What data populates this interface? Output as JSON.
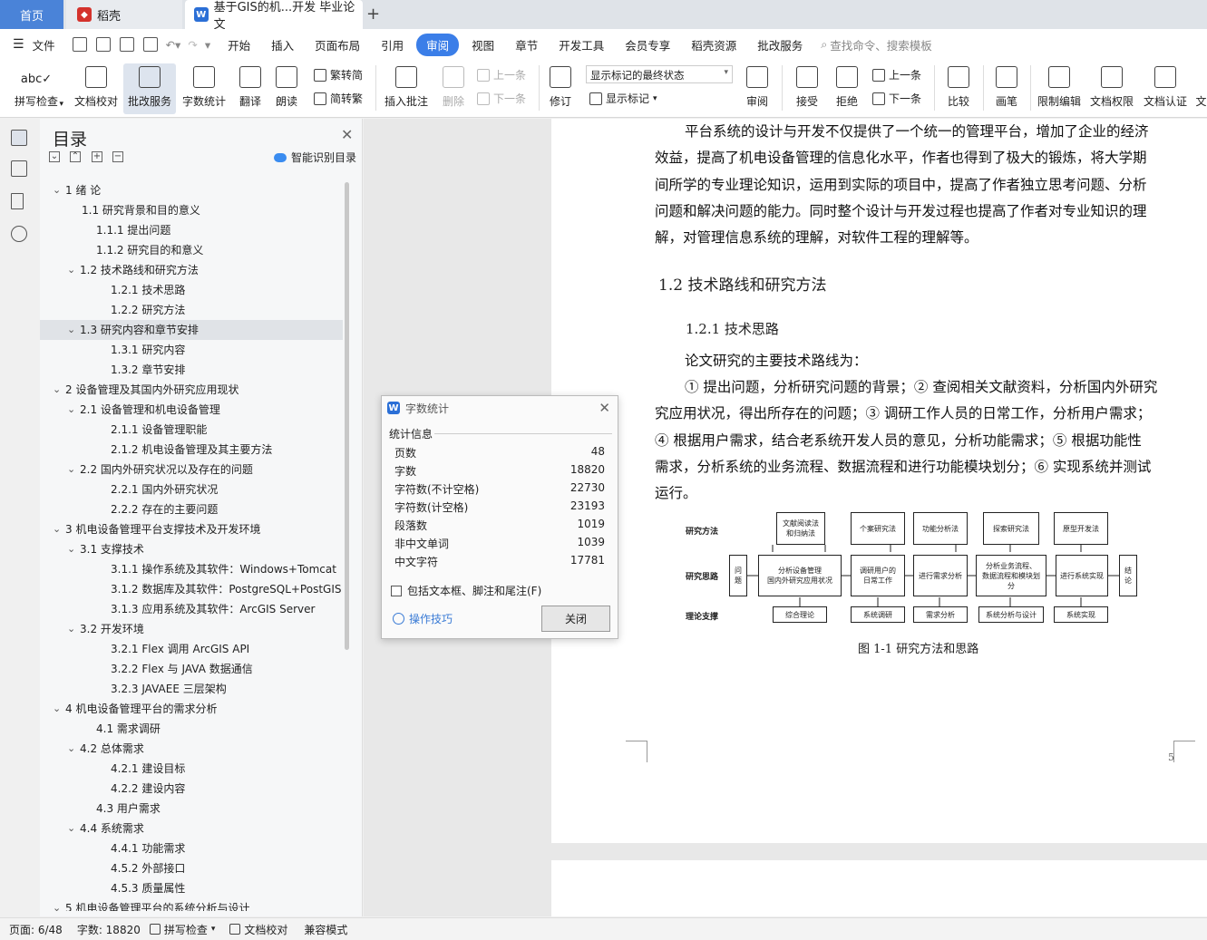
{
  "tabs": {
    "home": "首页",
    "daoke": "稻壳",
    "doc": "基于GIS的机...开发 毕业论文"
  },
  "menu": {
    "file": "文件",
    "items": [
      "开始",
      "插入",
      "页面布局",
      "引用",
      "审阅",
      "视图",
      "章节",
      "开发工具",
      "会员专享",
      "稻壳资源",
      "批改服务"
    ],
    "active": "审阅",
    "search": "查找命令、搜索模板"
  },
  "ribbon": {
    "spell": "拼写检查",
    "doccheck": "文档校对",
    "review_service": "批改服务",
    "wordcount": "字数统计",
    "translate": "翻译",
    "read": "朗读",
    "trad": "繁转简",
    "simp": "简转繁",
    "insert_comment": "插入批注",
    "delete": "删除",
    "prev": "上一条",
    "next": "下一条",
    "revise": "修订",
    "markup_state": "显示标记的最终状态",
    "show_markup": "显示标记",
    "review": "审阅",
    "accept": "接受",
    "reject": "拒绝",
    "prev2": "上一条",
    "next2": "下一条",
    "compare": "比较",
    "pen": "画笔",
    "restrict": "限制编辑",
    "perm": "文档权限",
    "auth": "文档认证",
    "more": "文"
  },
  "toc": {
    "title": "目录",
    "smart": "智能识别目录",
    "items": [
      {
        "text": "1  绪    论",
        "level": 1,
        "exp": true
      },
      {
        "text": "1.1  研究背景和目的意义",
        "level": 2
      },
      {
        "text": "1.1.1  提出问题",
        "level": 3
      },
      {
        "text": "1.1.2  研究目的和意义",
        "level": 3
      },
      {
        "text": "1.2  技术路线和研究方法",
        "level": 2,
        "exp": true
      },
      {
        "text": "1.2.1  技术思路",
        "level": 4
      },
      {
        "text": "1.2.2  研究方法",
        "level": 4
      },
      {
        "text": "1.3  研究内容和章节安排",
        "level": 2,
        "exp": true,
        "sel": true
      },
      {
        "text": "1.3.1  研究内容",
        "level": 4
      },
      {
        "text": "1.3.2  章节安排",
        "level": 4
      },
      {
        "text": "2  设备管理及其国内外研究应用现状",
        "level": 1,
        "exp": true
      },
      {
        "text": "2.1  设备管理和机电设备管理",
        "level": 2,
        "exp": true
      },
      {
        "text": "2.1.1  设备管理职能",
        "level": 4
      },
      {
        "text": "2.1.2  机电设备管理及其主要方法",
        "level": 4
      },
      {
        "text": "2.2  国内外研究状况以及存在的问题",
        "level": 2,
        "exp": true
      },
      {
        "text": "2.2.1  国内外研究状况",
        "level": 4
      },
      {
        "text": "2.2.2  存在的主要问题",
        "level": 4
      },
      {
        "text": "3  机电设备管理平台支撑技术及开发环境",
        "level": 1,
        "exp": true
      },
      {
        "text": "3.1  支撑技术",
        "level": 2,
        "exp": true
      },
      {
        "text": "3.1.1  操作系统及其软件：Windows+Tomcat",
        "level": 4
      },
      {
        "text": "3.1.2  数据库及其软件：PostgreSQL+PostGIS",
        "level": 4
      },
      {
        "text": "3.1.3  应用系统及其软件：ArcGIS Server",
        "level": 4
      },
      {
        "text": "3.2  开发环境",
        "level": 2,
        "exp": true
      },
      {
        "text": "3.2.1 Flex 调用 ArcGIS API",
        "level": 4
      },
      {
        "text": "3.2.2 Flex 与 JAVA 数据通信",
        "level": 4
      },
      {
        "text": "3.2.3 JAVAEE 三层架构",
        "level": 4
      },
      {
        "text": "4  机电设备管理平台的需求分析",
        "level": 1,
        "exp": true
      },
      {
        "text": "4.1  需求调研",
        "level": 3
      },
      {
        "text": "4.2  总体需求",
        "level": 2,
        "exp": true
      },
      {
        "text": "4.2.1  建设目标",
        "level": 4
      },
      {
        "text": "4.2.2  建设内容",
        "level": 4
      },
      {
        "text": "4.3  用户需求",
        "level": 3
      },
      {
        "text": "4.4  系统需求",
        "level": 2,
        "exp": true
      },
      {
        "text": "4.4.1  功能需求",
        "level": 4
      },
      {
        "text": "4.5.2  外部接口",
        "level": 4
      },
      {
        "text": "4.5.3  质量属性",
        "level": 4
      },
      {
        "text": "5  机电设备管理平台的系统分析与设计",
        "level": 1,
        "exp": true
      }
    ]
  },
  "document": {
    "para1": [
      "平台系统的设计与开发不仅提供了一个统一的管理平台，增加了企业的经济",
      "效益，提高了机电设备管理的信息化水平，作者也得到了极大的锻炼，将大学期",
      "间所学的专业理论知识，运用到实际的项目中，提高了作者独立思考问题、分析",
      "问题和解决问题的能力。同时整个设计与开发过程也提高了作者对专业知识的理",
      "解，对管理信息系统的理解，对软件工程的理解等。"
    ],
    "h2": "1.2  技术路线和研究方法",
    "h3": "1.2.1  技术思路",
    "para2": "论文研究的主要技术路线为：",
    "para3": [
      "① 提出问题，分析研究问题的背景；② 查阅相关文献资料，分析国内外研究",
      "究应用状况，得出所存在的问题；③ 调研工作人员的日常工作，分析用户需求；",
      "④ 根据用户需求，结合老系统开发人员的意见，分析功能需求；⑤ 根据功能性",
      "需求，分析系统的业务流程、数据流程和进行功能模块划分；⑥ 实现系统并测试",
      "运行。"
    ],
    "caption": "图 1-1    研究方法和思路",
    "page_num": "5",
    "diagram": {
      "row_labels": [
        "研究方法",
        "研究思路",
        "理论支撑"
      ],
      "methods": [
        "文献阅读法\n和归纳法",
        "个案研究法",
        "功能分析法",
        "探索研究法",
        "原型开发法"
      ],
      "flow": [
        "问\n题",
        "分析设备管理\n国内外研究应用状况",
        "调研用户的\n日常工作",
        "进行需求分析",
        "分析业务流程、\n数据流程和模块划\n分",
        "进行系统实现",
        "结\n论"
      ],
      "theory": [
        "综合理论",
        "系统调研",
        "需求分析",
        "系统分析与设计",
        "系统实现"
      ]
    }
  },
  "dialog": {
    "title": "字数统计",
    "section": "统计信息",
    "rows": [
      {
        "label": "页数",
        "value": "48"
      },
      {
        "label": "字数",
        "value": "18820"
      },
      {
        "label": "字符数(不计空格)",
        "value": "22730"
      },
      {
        "label": "字符数(计空格)",
        "value": "23193"
      },
      {
        "label": "段落数",
        "value": "1019"
      },
      {
        "label": "非中文单词",
        "value": "1039"
      },
      {
        "label": "中文字符",
        "value": "17781"
      }
    ],
    "checkbox": "包括文本框、脚注和尾注(F)",
    "tips": "操作技巧",
    "close": "关闭"
  },
  "status": {
    "page": "页面: 6/48",
    "words": "字数: 18820",
    "spell": "拼写检查",
    "doccheck": "文档校对",
    "compat": "兼容模式"
  },
  "colors": {
    "accent": "#3b7ee8",
    "home_tab": "#4a83d8",
    "wps_red": "#d4322c",
    "wps_blue": "#2b6fd6"
  }
}
